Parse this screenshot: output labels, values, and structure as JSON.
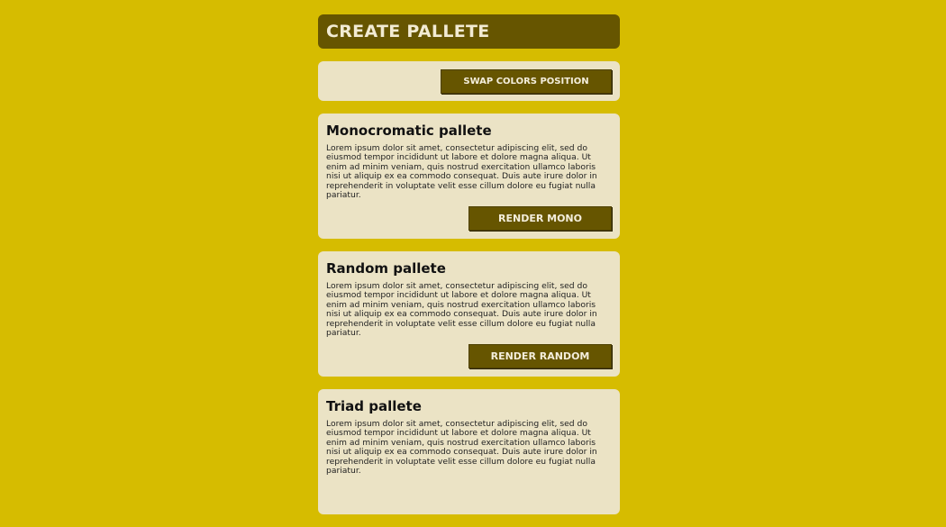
{
  "header": {
    "title": "CREATE PALLETE"
  },
  "swap": {
    "button_label": "SWAP COLORS POSITION"
  },
  "palettes": [
    {
      "title": "Monocromatic pallete",
      "description": "Lorem ipsum dolor sit amet, consectetur adipiscing elit, sed do eiusmod tempor incididunt ut labore et dolore magna aliqua. Ut enim ad minim veniam, quis nostrud exercitation ullamco laboris nisi ut aliquip ex ea commodo consequat. Duis aute irure dolor in reprehenderit in voluptate velit esse cillum dolore eu fugiat nulla pariatur.",
      "button_label": "RENDER MONO"
    },
    {
      "title": "Random pallete",
      "description": "Lorem ipsum dolor sit amet, consectetur adipiscing elit, sed do eiusmod tempor incididunt ut labore et dolore magna aliqua. Ut enim ad minim veniam, quis nostrud exercitation ullamco laboris nisi ut aliquip ex ea commodo consequat. Duis aute irure dolor in reprehenderit in voluptate velit esse cillum dolore eu fugiat nulla pariatur.",
      "button_label": "RENDER RANDOM"
    },
    {
      "title": "Triad pallete",
      "description": "Lorem ipsum dolor sit amet, consectetur adipiscing elit, sed do eiusmod tempor incididunt ut labore et dolore magna aliqua. Ut enim ad minim veniam, quis nostrud exercitation ullamco laboris nisi ut aliquip ex ea commodo consequat. Duis aute irure dolor in reprehenderit in voluptate velit esse cillum dolore eu fugiat nulla pariatur."
    }
  ],
  "colors": {
    "background": "#d6bc00",
    "accent": "#665500",
    "card": "#ebe3c5"
  }
}
